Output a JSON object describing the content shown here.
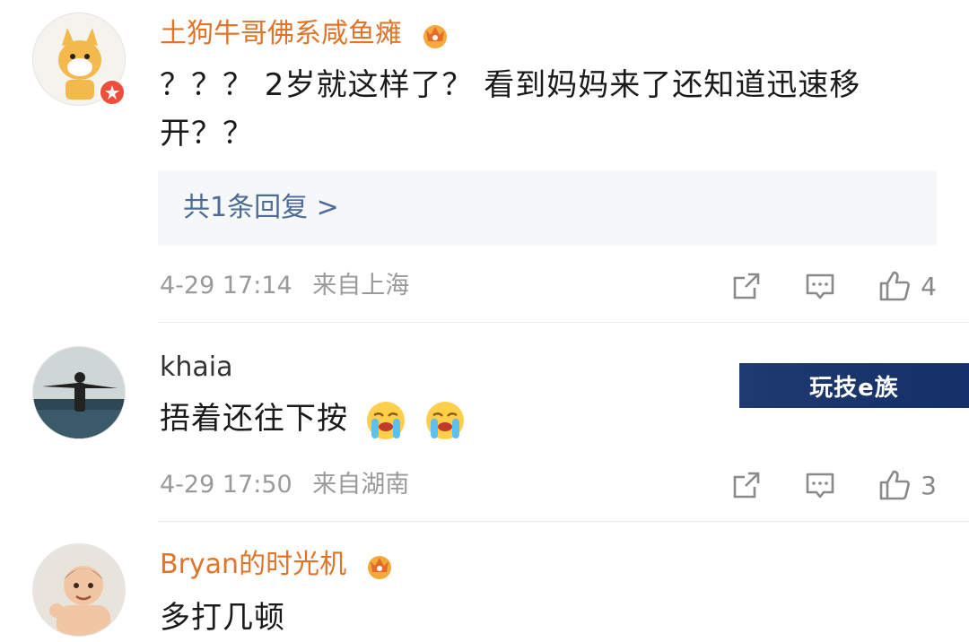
{
  "comments": [
    {
      "username": "土狗牛哥佛系咸鱼瘫",
      "text": "？？？ 2岁就这样了？ 看到妈妈来了还知道迅速移开？？",
      "replies_label": "共1条回复 >",
      "timestamp": "4-29 17:14",
      "location": "来自上海",
      "likes": "4"
    },
    {
      "username": "khaia",
      "text": "捂着还往下按",
      "timestamp": "4-29 17:50",
      "location": "来自湖南",
      "likes": "3"
    },
    {
      "username": "Bryan的时光机",
      "text": "多打几顿"
    }
  ],
  "watermark": "玩技e族",
  "colors": {
    "vip_name": "#e0742a",
    "reply_link": "#4d6b95",
    "meta": "#9a9a9a"
  },
  "icons": [
    "crown-badge-icon",
    "share-icon",
    "comment-icon",
    "like-icon",
    "crying-emoji-icon"
  ]
}
